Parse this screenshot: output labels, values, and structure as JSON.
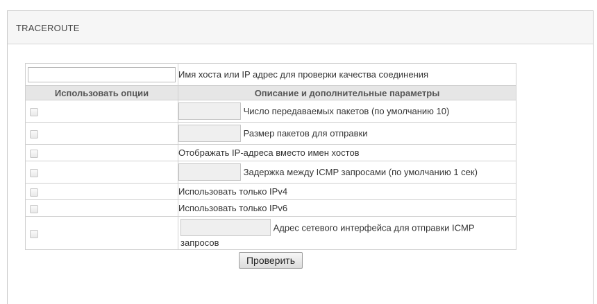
{
  "panel": {
    "title": "TRACEROUTE"
  },
  "host": {
    "value": "",
    "label": "Имя хоста или IP адрес для проверки качества соединения"
  },
  "table": {
    "header_use": "Использовать опции",
    "header_desc": "Описание и дополнительные параметры"
  },
  "options": {
    "packet_count": {
      "checked": false,
      "value": "",
      "label": "Число передаваемых пакетов (по умолчанию 10)"
    },
    "packet_size": {
      "checked": false,
      "value": "",
      "label": "Размер пакетов для отправки"
    },
    "show_ip": {
      "checked": false,
      "label": "Отображать IP-адреса вместо имен хостов"
    },
    "icmp_delay": {
      "checked": false,
      "value": "",
      "label": "Задержка между ICMP запросами (по умолчанию 1 сек)"
    },
    "ipv4_only": {
      "checked": false,
      "label": "Использовать только IPv4"
    },
    "ipv6_only": {
      "checked": false,
      "label": "Использовать только IPv6"
    },
    "iface_addr": {
      "checked": false,
      "value": "",
      "label_line1": "Адрес сетевого интерфейса для отправки ICMP",
      "label_line2": "запросов"
    }
  },
  "actions": {
    "check_label": "Проверить"
  }
}
